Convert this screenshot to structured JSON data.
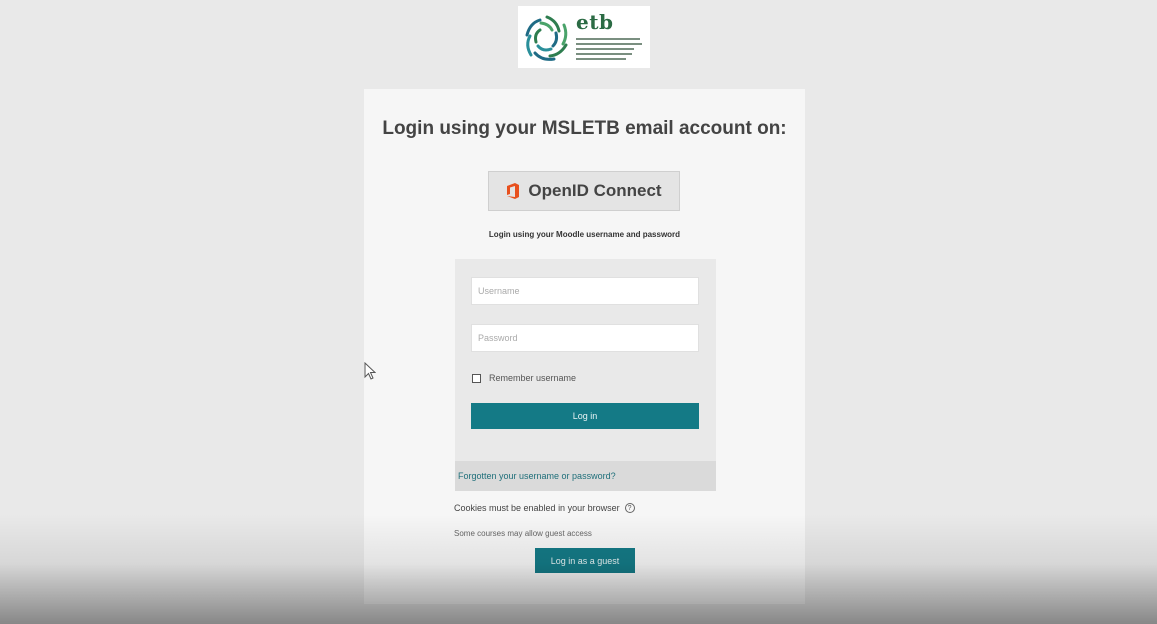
{
  "logo": {
    "wordmark": "etb",
    "brand_color": "#2b6b44"
  },
  "openid": {
    "heading": "Login using your MSLETB email account on:",
    "button_label": "OpenID Connect",
    "icon": "office-icon",
    "icon_color": "#e8501e"
  },
  "moodle_login_text": "Login using your Moodle username and password",
  "form": {
    "username_placeholder": "Username",
    "password_placeholder": "Password",
    "remember_label": "Remember username",
    "remember_checked": false,
    "login_button": "Log in",
    "forgot_link": "Forgotten your username or password?"
  },
  "cookies_text": "Cookies must be enabled in your browser",
  "guest": {
    "note": "Some courses may allow guest access",
    "button_label": "Log in as a guest"
  },
  "colors": {
    "accent": "#147a86",
    "background": "#e9e9e9",
    "card": "#f6f6f6"
  }
}
